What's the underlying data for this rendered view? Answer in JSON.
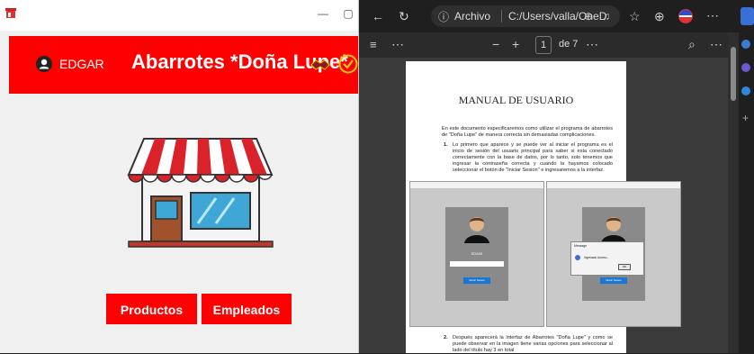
{
  "app": {
    "window_min": "—",
    "window_max": "▢",
    "user_name": "EDGAR",
    "title": "Abarrotes *Doña Lupe*",
    "buttons": {
      "productos": "Productos",
      "empleados": "Empleados"
    },
    "colors": {
      "header": "#ff0000",
      "accent": "#ffcc00"
    }
  },
  "browser": {
    "address": {
      "label": "Archivo",
      "url": "C:/Users/valla/OneDriv..."
    },
    "pdf_toolbar": {
      "page_current": "1",
      "page_total": "de 7"
    },
    "document": {
      "title": "MANUAL DE USUARIO",
      "intro": "En este documento especificaremos como utilizar el programa de abarrotes de \"Doña Lupe\" de manera correcta sin demasiadas complicaciones.",
      "items": [
        {
          "num": "1.",
          "text": "Lo primero que aparece y se puede ver al iniciar el programa es el inicio de sesión del usuario principal para saber si esta conectado correctamente con la base de datos, por lo tanto, solo tenemos que ingresar la contraseña correcta y cuando la hayamos colocado seleccionar el botón de \"Iniciar Sesion\" e ingresaremos a la interfaz."
        },
        {
          "num": "2.",
          "text": "Después aparecerá la interfaz de Abarrotes \"Doña Lupe\" y como se puede observar en la imagen tiene varias opciones para seleccionar al lado del título hay 3 en total"
        }
      ],
      "screens": {
        "user_label": "EDGAR",
        "login_button": "Iniciar Sesion",
        "message_title": "Message",
        "message_text": "Ingresado Acceso...",
        "ok_label": "OK"
      }
    }
  }
}
